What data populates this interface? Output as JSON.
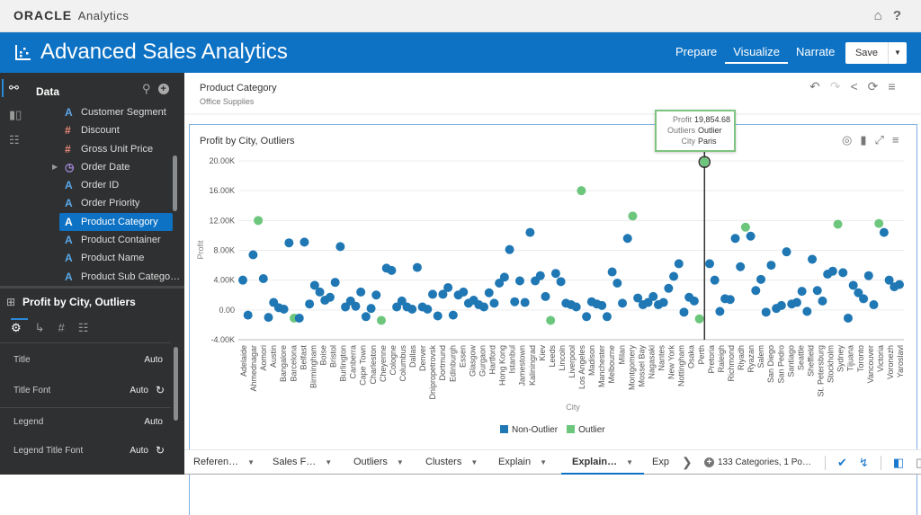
{
  "app": {
    "brand": "ORACLE",
    "brand_product": "Analytics",
    "title": "Advanced Sales Analytics",
    "top_icons": [
      "home-icon",
      "help-icon"
    ]
  },
  "nav": {
    "items": [
      {
        "label": "Prepare",
        "active": false
      },
      {
        "label": "Visualize",
        "active": true
      },
      {
        "label": "Narrate",
        "active": false
      }
    ],
    "save_label": "Save"
  },
  "sidebar": {
    "header": "Data",
    "fields": [
      {
        "label": "Customer Segment",
        "type": "attribute"
      },
      {
        "label": "Discount",
        "type": "measure"
      },
      {
        "label": "Gross Unit Price",
        "type": "measure"
      },
      {
        "label": "Order Date",
        "type": "time",
        "expandable": true
      },
      {
        "label": "Order ID",
        "type": "attribute"
      },
      {
        "label": "Order Priority",
        "type": "attribute"
      },
      {
        "label": "Product Category",
        "type": "attribute",
        "selected": true
      },
      {
        "label": "Product Container",
        "type": "attribute"
      },
      {
        "label": "Product Name",
        "type": "attribute"
      },
      {
        "label": "Product Sub Catego…",
        "type": "attribute"
      }
    ],
    "properties": {
      "title": "Profit by City, Outliers",
      "rows": [
        {
          "label": "Title",
          "value": "Auto",
          "reset": false
        },
        {
          "label": "Title Font",
          "value": "Auto",
          "reset": true
        },
        {
          "label": "Legend",
          "value": "Auto",
          "reset": false
        },
        {
          "label": "Legend Title Font",
          "value": "Auto",
          "reset": true
        }
      ]
    }
  },
  "filter": {
    "title": "Product Category",
    "value": "Office Supplies"
  },
  "viz": {
    "title": "Profit by City, Outliers"
  },
  "tooltip": {
    "rows": [
      {
        "key": "Profit",
        "value": "19,854.68"
      },
      {
        "key": "Outliers",
        "value": "Outlier"
      },
      {
        "key": "City",
        "value": "Paris"
      }
    ]
  },
  "colors": {
    "non_outlier": "#1f77b4",
    "outlier": "#6cc77d",
    "accent": "#0d72c4"
  },
  "chart_data": {
    "type": "scatter",
    "title": "Profit by City, Outliers",
    "xlabel": "City",
    "ylabel": "Profit",
    "ylim": [
      -4000,
      20000
    ],
    "yticks": [
      20000,
      16000,
      12000,
      8000,
      4000,
      0,
      -4000
    ],
    "ytick_labels": [
      "20.00K",
      "16.00K",
      "12.00K",
      "8.00K",
      "4.00K",
      "0.00",
      "-4.00K"
    ],
    "grid": true,
    "legend": {
      "position": "bottom",
      "entries": [
        "Non-Outlier",
        "Outlier"
      ]
    },
    "x_labels": [
      "Adelaide",
      "Ahmednagar",
      "Aomori",
      "Austin",
      "Bangalore",
      "Barcelona",
      "Belfast",
      "Birmingham",
      "Boise",
      "Bristol",
      "Burlington",
      "Canberra",
      "Cape Town",
      "Charleston",
      "Cheyenne",
      "Cologne",
      "Columbus",
      "Dallas",
      "Denver",
      "Dnipropetrovsk",
      "Dortmund",
      "Edinburgh",
      "Essen",
      "Glasgow",
      "Gurgaon",
      "Hartford",
      "Hong Kong",
      "Istanbul",
      "Jamestown",
      "Kaliningrad",
      "Kiev",
      "Leeds",
      "Lincoln",
      "Liverpool",
      "Los Angeles",
      "Madison",
      "Manchester",
      "Melbourne",
      "Milan",
      "Montgomery",
      "Mossel Bay",
      "Nagasaki",
      "Nantes",
      "New York",
      "Nottingham",
      "Osaka",
      "Perth",
      "Pretoria",
      "Raleigh",
      "Richmond",
      "Riyadh",
      "Ryazan",
      "Salem",
      "San Diego",
      "San Pedro",
      "Santiago",
      "Seattle",
      "Sheffield",
      "St. Petersburg",
      "Stockholm",
      "Sydney",
      "Tijuana",
      "Toronto",
      "Vancouver",
      "Victoria",
      "Voronezh",
      "Yaroslavl"
    ],
    "total_categories": 133,
    "highlight": {
      "city": "Paris",
      "profit": 19854.68,
      "outlier": "Outlier"
    },
    "points": [
      [
        0,
        4000,
        0
      ],
      [
        1,
        -700,
        0
      ],
      [
        2,
        7400,
        0
      ],
      [
        3,
        12000,
        1
      ],
      [
        4,
        4200,
        0
      ],
      [
        5,
        -1000,
        0
      ],
      [
        6,
        1000,
        0
      ],
      [
        7,
        300,
        0
      ],
      [
        8,
        100,
        0
      ],
      [
        9,
        9000,
        0
      ],
      [
        10,
        -1100,
        1
      ],
      [
        11,
        -1100,
        0
      ],
      [
        12,
        9100,
        0
      ],
      [
        13,
        800,
        0
      ],
      [
        14,
        3300,
        0
      ],
      [
        15,
        2400,
        0
      ],
      [
        16,
        1300,
        0
      ],
      [
        17,
        1700,
        0
      ],
      [
        18,
        3700,
        0
      ],
      [
        19,
        8500,
        0
      ],
      [
        20,
        400,
        0
      ],
      [
        21,
        1200,
        0
      ],
      [
        22,
        500,
        0
      ],
      [
        23,
        2400,
        0
      ],
      [
        24,
        -900,
        0
      ],
      [
        25,
        200,
        0
      ],
      [
        26,
        2000,
        0
      ],
      [
        27,
        -1400,
        1
      ],
      [
        28,
        5600,
        0
      ],
      [
        29,
        5300,
        0
      ],
      [
        30,
        400,
        0
      ],
      [
        31,
        1200,
        0
      ],
      [
        32,
        400,
        0
      ],
      [
        33,
        100,
        0
      ],
      [
        34,
        5700,
        0
      ],
      [
        35,
        400,
        0
      ],
      [
        36,
        100,
        0
      ],
      [
        37,
        2100,
        0
      ],
      [
        38,
        -800,
        0
      ],
      [
        39,
        2100,
        0
      ],
      [
        40,
        3000,
        0
      ],
      [
        41,
        -700,
        0
      ],
      [
        42,
        2000,
        0
      ],
      [
        43,
        2400,
        0
      ],
      [
        44,
        900,
        0
      ],
      [
        45,
        1300,
        0
      ],
      [
        46,
        700,
        0
      ],
      [
        47,
        400,
        0
      ],
      [
        48,
        2300,
        0
      ],
      [
        49,
        900,
        0
      ],
      [
        50,
        3600,
        0
      ],
      [
        51,
        4400,
        0
      ],
      [
        52,
        8100,
        0
      ],
      [
        53,
        1100,
        0
      ],
      [
        54,
        3900,
        0
      ],
      [
        55,
        1000,
        0
      ],
      [
        56,
        10400,
        0
      ],
      [
        57,
        3900,
        0
      ],
      [
        58,
        4600,
        0
      ],
      [
        59,
        1800,
        0
      ],
      [
        60,
        -1400,
        1
      ],
      [
        61,
        4900,
        0
      ],
      [
        62,
        3800,
        0
      ],
      [
        63,
        900,
        0
      ],
      [
        64,
        700,
        0
      ],
      [
        65,
        400,
        0
      ],
      [
        66,
        16000,
        1
      ],
      [
        67,
        -900,
        0
      ],
      [
        68,
        1100,
        0
      ],
      [
        69,
        800,
        0
      ],
      [
        70,
        600,
        0
      ],
      [
        71,
        -900,
        0
      ],
      [
        72,
        5100,
        0
      ],
      [
        73,
        3600,
        0
      ],
      [
        74,
        900,
        0
      ],
      [
        75,
        9600,
        0
      ],
      [
        76,
        12600,
        1
      ],
      [
        77,
        1600,
        0
      ],
      [
        78,
        700,
        0
      ],
      [
        79,
        1000,
        0
      ],
      [
        80,
        1800,
        0
      ],
      [
        81,
        700,
        0
      ],
      [
        82,
        1000,
        0
      ],
      [
        83,
        2900,
        0
      ],
      [
        84,
        4500,
        0
      ],
      [
        85,
        6200,
        0
      ],
      [
        86,
        -300,
        0
      ],
      [
        87,
        1700,
        0
      ],
      [
        88,
        1200,
        0
      ],
      [
        89,
        -1200,
        1
      ],
      [
        90,
        19854.68,
        1
      ],
      [
        91,
        6200,
        0
      ],
      [
        92,
        4000,
        0
      ],
      [
        93,
        -200,
        0
      ],
      [
        94,
        1500,
        0
      ],
      [
        95,
        1400,
        0
      ],
      [
        96,
        9600,
        0
      ],
      [
        97,
        5800,
        0
      ],
      [
        98,
        11100,
        1
      ],
      [
        99,
        9900,
        0
      ],
      [
        100,
        2600,
        0
      ],
      [
        101,
        4100,
        0
      ],
      [
        102,
        -300,
        0
      ],
      [
        103,
        6000,
        0
      ],
      [
        104,
        200,
        0
      ],
      [
        105,
        600,
        0
      ],
      [
        106,
        7800,
        0
      ],
      [
        107,
        800,
        0
      ],
      [
        108,
        1000,
        0
      ],
      [
        109,
        2500,
        0
      ],
      [
        110,
        -200,
        0
      ],
      [
        111,
        6800,
        0
      ],
      [
        112,
        2600,
        0
      ],
      [
        113,
        1200,
        0
      ],
      [
        114,
        4800,
        0
      ],
      [
        115,
        5200,
        0
      ],
      [
        116,
        11500,
        1
      ],
      [
        117,
        5000,
        0
      ],
      [
        118,
        -1100,
        0
      ],
      [
        119,
        3300,
        0
      ],
      [
        120,
        2300,
        0
      ],
      [
        121,
        1500,
        0
      ],
      [
        122,
        4600,
        0
      ],
      [
        123,
        700,
        0
      ],
      [
        124,
        11600,
        1
      ],
      [
        125,
        10400,
        0
      ],
      [
        126,
        4000,
        0
      ],
      [
        127,
        3100,
        0
      ],
      [
        128,
        3400,
        0
      ]
    ]
  },
  "tabs": [
    {
      "label": "Referen…",
      "active": false
    },
    {
      "label": "Sales F…",
      "active": false
    },
    {
      "label": "Outliers",
      "active": false
    },
    {
      "label": "Clusters",
      "active": false
    },
    {
      "label": "Explain",
      "active": false
    },
    {
      "label": "Explain…",
      "active": true
    },
    {
      "label": "Exp",
      "active": false
    }
  ],
  "status": {
    "categories": "133 Categories, 1 Po…"
  }
}
